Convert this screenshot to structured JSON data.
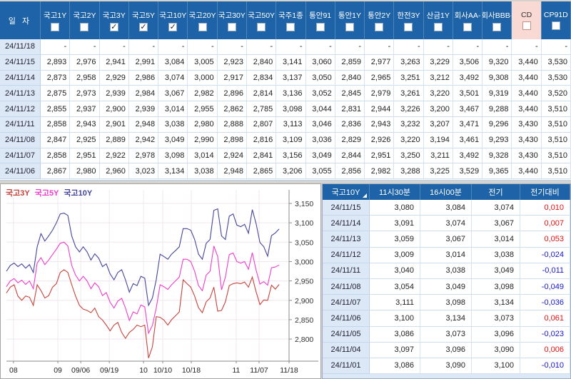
{
  "colors": {
    "header_blue": "#1e63a8",
    "cd_highlight_pink": "#f9d9d3",
    "date_cell_blue": "#dce8f5",
    "positive_red": "#e01414",
    "negative_blue": "#1616cc",
    "grid_line": "#f2e6ee",
    "axis_gray": "#8a8a8a"
  },
  "top_table": {
    "date_header": "일 자",
    "columns": [
      {
        "label": "국고1Y",
        "checked": false,
        "highlight": false
      },
      {
        "label": "국고2Y",
        "checked": false,
        "highlight": false
      },
      {
        "label": "국고3Y",
        "checked": true,
        "highlight": false
      },
      {
        "label": "국고5Y",
        "checked": true,
        "highlight": false
      },
      {
        "label": "국고10Y",
        "checked": true,
        "highlight": false
      },
      {
        "label": "국고20Y",
        "checked": false,
        "highlight": false
      },
      {
        "label": "국고30Y",
        "checked": false,
        "highlight": false
      },
      {
        "label": "국고50Y",
        "checked": false,
        "highlight": false
      },
      {
        "label": "국주1종",
        "checked": false,
        "highlight": false
      },
      {
        "label": "통안91",
        "checked": false,
        "highlight": false
      },
      {
        "label": "통안1Y",
        "checked": false,
        "highlight": false
      },
      {
        "label": "통안2Y",
        "checked": false,
        "highlight": false
      },
      {
        "label": "한전3Y",
        "checked": false,
        "highlight": false
      },
      {
        "label": "산금1Y",
        "checked": false,
        "highlight": false
      },
      {
        "label": "회사AA-",
        "checked": false,
        "highlight": false
      },
      {
        "label": "회사BBB-",
        "checked": false,
        "highlight": false
      },
      {
        "label": "CD",
        "checked": false,
        "highlight": true
      },
      {
        "label": "CP91D",
        "checked": false,
        "highlight": false
      }
    ],
    "rows": [
      {
        "date": "24/11/18",
        "values": [
          "-",
          "-",
          "-",
          "-",
          "-",
          "-",
          "-",
          "-",
          "-",
          "-",
          "-",
          "-",
          "-",
          "-",
          "-",
          "-",
          "-",
          "-"
        ]
      },
      {
        "date": "24/11/15",
        "values": [
          "2,893",
          "2,976",
          "2,941",
          "2,991",
          "3,084",
          "3,005",
          "2,923",
          "2,840",
          "3,141",
          "3,060",
          "2,859",
          "2,977",
          "3,263",
          "3,229",
          "3,506",
          "9,320",
          "3,440",
          "3,530"
        ]
      },
      {
        "date": "24/11/14",
        "values": [
          "2,873",
          "2,958",
          "2,929",
          "2,986",
          "3,074",
          "3,000",
          "2,917",
          "2,834",
          "3,137",
          "3,050",
          "2,840",
          "2,965",
          "3,251",
          "3,212",
          "3,492",
          "9,308",
          "3,440",
          "3,530"
        ]
      },
      {
        "date": "24/11/13",
        "values": [
          "2,875",
          "2,973",
          "2,939",
          "2,984",
          "3,067",
          "2,982",
          "2,896",
          "2,814",
          "3,136",
          "3,052",
          "2,845",
          "2,979",
          "3,261",
          "3,220",
          "3,501",
          "9,319",
          "3,440",
          "3,520"
        ]
      },
      {
        "date": "24/11/12",
        "values": [
          "2,855",
          "2,937",
          "2,900",
          "2,939",
          "3,014",
          "2,955",
          "2,862",
          "2,785",
          "3,098",
          "3,044",
          "2,831",
          "2,944",
          "3,226",
          "3,200",
          "3,467",
          "9,288",
          "3,440",
          "3,510"
        ]
      },
      {
        "date": "24/11/11",
        "values": [
          "2,858",
          "2,943",
          "2,901",
          "2,948",
          "3,038",
          "2,980",
          "2,888",
          "2,807",
          "3,113",
          "3,046",
          "2,836",
          "2,943",
          "3,232",
          "3,207",
          "3,471",
          "9,296",
          "3,430",
          "3,510"
        ]
      },
      {
        "date": "24/11/08",
        "values": [
          "2,847",
          "2,925",
          "2,889",
          "2,942",
          "3,049",
          "2,990",
          "2,898",
          "2,816",
          "3,109",
          "3,036",
          "2,829",
          "2,926",
          "3,220",
          "3,194",
          "3,461",
          "9,293",
          "3,430",
          "3,510"
        ]
      },
      {
        "date": "24/11/07",
        "values": [
          "2,858",
          "2,951",
          "2,922",
          "2,978",
          "3,098",
          "3,014",
          "2,924",
          "2,841",
          "3,156",
          "3,049",
          "2,844",
          "2,951",
          "3,250",
          "3,211",
          "3,492",
          "9,328",
          "3,430",
          "3,510"
        ]
      },
      {
        "date": "24/11/06",
        "values": [
          "2,867",
          "2,980",
          "2,960",
          "3,023",
          "3,134",
          "3,038",
          "2,948",
          "2,865",
          "3,206",
          "3,055",
          "2,856",
          "2,982",
          "3,288",
          "3,225",
          "3,529",
          "9,365",
          "3,440",
          "3,510"
        ]
      }
    ]
  },
  "chart_data": {
    "type": "line",
    "title": "",
    "xlabel": "",
    "ylabel": "",
    "grid": true,
    "legend_position": "top-left",
    "ylim": [
      2.743,
      3.185
    ],
    "y_ticks": [
      2.8,
      2.85,
      2.9,
      2.95,
      3.0,
      3.05,
      3.1,
      3.15
    ],
    "y_tick_labels": [
      "2,800",
      "2,850",
      "2,900",
      "2,950",
      "3,000",
      "3,050",
      "3,100",
      "3,150"
    ],
    "x_tick_labels": [
      "08",
      "09",
      "09/06",
      "09/19",
      "10",
      "10/10",
      "10/18",
      "11",
      "11/07",
      "11/18"
    ],
    "x_tick_fracs": [
      0.025,
      0.182,
      0.263,
      0.364,
      0.485,
      0.553,
      0.654,
      0.813,
      0.894,
      1.0
    ],
    "last_point_frac": 0.965,
    "series": [
      {
        "name": "국고3Y",
        "color": "#c8423a",
        "values": [
          2.919,
          2.934,
          2.94,
          2.911,
          2.9,
          2.911,
          2.908,
          2.887,
          2.94,
          2.925,
          2.906,
          2.912,
          2.934,
          2.943,
          2.972,
          2.979,
          2.972,
          2.94,
          2.911,
          2.887,
          2.877,
          2.874,
          2.868,
          2.88,
          2.858,
          2.849,
          2.836,
          2.821,
          2.836,
          2.843,
          2.817,
          2.802,
          2.817,
          2.825,
          2.836,
          2.832,
          2.836,
          2.751,
          2.78,
          2.858,
          2.856,
          2.849,
          2.836,
          2.85,
          2.86,
          2.87,
          2.953,
          2.943,
          2.934,
          2.911,
          2.881,
          2.868,
          2.896,
          2.906,
          2.934,
          2.872,
          2.874,
          2.896,
          2.938,
          2.943,
          2.945,
          2.943,
          2.947,
          2.934,
          2.96,
          2.922,
          2.889,
          2.901,
          2.9,
          2.939,
          2.929,
          2.941
        ]
      },
      {
        "name": "국고5Y",
        "color": "#ee3ecc",
        "values": [
          2.935,
          2.95,
          2.956,
          2.945,
          2.952,
          2.941,
          2.95,
          2.93,
          2.996,
          3.01,
          2.992,
          3.004,
          3.018,
          3.032,
          3.047,
          3.05,
          3.04,
          2.99,
          2.965,
          2.95,
          2.962,
          2.95,
          2.93,
          2.945,
          2.935,
          2.912,
          2.92,
          2.895,
          2.88,
          2.898,
          2.905,
          2.88,
          2.848,
          2.87,
          2.865,
          2.888,
          2.883,
          2.815,
          2.835,
          2.88,
          2.94,
          2.935,
          2.928,
          2.94,
          2.95,
          2.96,
          3.006,
          3.006,
          3.0,
          2.975,
          2.938,
          2.925,
          2.965,
          2.975,
          3.04,
          3.013,
          2.927,
          2.96,
          3.018,
          3.022,
          3.0,
          2.996,
          3.0,
          2.98,
          3.023,
          2.978,
          2.942,
          2.948,
          2.939,
          2.984,
          2.986,
          2.991
        ]
      },
      {
        "name": "국고10Y",
        "color": "#44459a",
        "values": [
          2.975,
          2.99,
          2.996,
          2.987,
          2.994,
          2.983,
          2.992,
          2.972,
          3.038,
          3.072,
          3.053,
          3.066,
          3.081,
          3.1,
          3.123,
          3.125,
          3.119,
          3.066,
          3.038,
          3.025,
          3.038,
          3.025,
          3.004,
          3.02,
          3.009,
          2.987,
          2.994,
          2.968,
          2.953,
          2.972,
          2.979,
          2.953,
          2.921,
          2.943,
          2.938,
          2.962,
          2.957,
          2.887,
          2.906,
          2.953,
          3.019,
          3.013,
          3.006,
          3.019,
          3.028,
          3.038,
          3.085,
          3.085,
          3.081,
          3.057,
          3.019,
          3.006,
          3.047,
          3.057,
          3.132,
          3.136,
          3.066,
          3.057,
          3.117,
          3.123,
          3.094,
          3.09,
          3.096,
          3.073,
          3.134,
          3.098,
          3.049,
          3.038,
          3.014,
          3.067,
          3.074,
          3.084
        ]
      }
    ]
  },
  "quote_table": {
    "headers": [
      "국고10Y",
      "11시30분",
      "16시00분",
      "전기",
      "전기대비"
    ],
    "rows": [
      {
        "date": "24/11/15",
        "t1130": "3,080",
        "t1600": "3,084",
        "prev": "3,074",
        "diff": "0,010",
        "dir": "up"
      },
      {
        "date": "24/11/14",
        "t1130": "3,091",
        "t1600": "3,074",
        "prev": "3,067",
        "diff": "0,007",
        "dir": "up"
      },
      {
        "date": "24/11/13",
        "t1130": "3,059",
        "t1600": "3,067",
        "prev": "3,014",
        "diff": "0,053",
        "dir": "up"
      },
      {
        "date": "24/11/12",
        "t1130": "3,009",
        "t1600": "3,014",
        "prev": "3,038",
        "diff": "-0,024",
        "dir": "down"
      },
      {
        "date": "24/11/11",
        "t1130": "3,040",
        "t1600": "3,038",
        "prev": "3,049",
        "diff": "-0,011",
        "dir": "down"
      },
      {
        "date": "24/11/08",
        "t1130": "3,054",
        "t1600": "3,049",
        "prev": "3,098",
        "diff": "-0,049",
        "dir": "down"
      },
      {
        "date": "24/11/07",
        "t1130": "3,111",
        "t1600": "3,098",
        "prev": "3,134",
        "diff": "-0,036",
        "dir": "down"
      },
      {
        "date": "24/11/06",
        "t1130": "3,100",
        "t1600": "3,134",
        "prev": "3,073",
        "diff": "0,061",
        "dir": "up"
      },
      {
        "date": "24/11/05",
        "t1130": "3,086",
        "t1600": "3,073",
        "prev": "3,096",
        "diff": "-0,023",
        "dir": "down"
      },
      {
        "date": "24/11/04",
        "t1130": "3,097",
        "t1600": "3,096",
        "prev": "3,090",
        "diff": "0,006",
        "dir": "up"
      },
      {
        "date": "24/11/01",
        "t1130": "3,086",
        "t1600": "3,090",
        "prev": "3,100",
        "diff": "-0,010",
        "dir": "down"
      }
    ]
  }
}
